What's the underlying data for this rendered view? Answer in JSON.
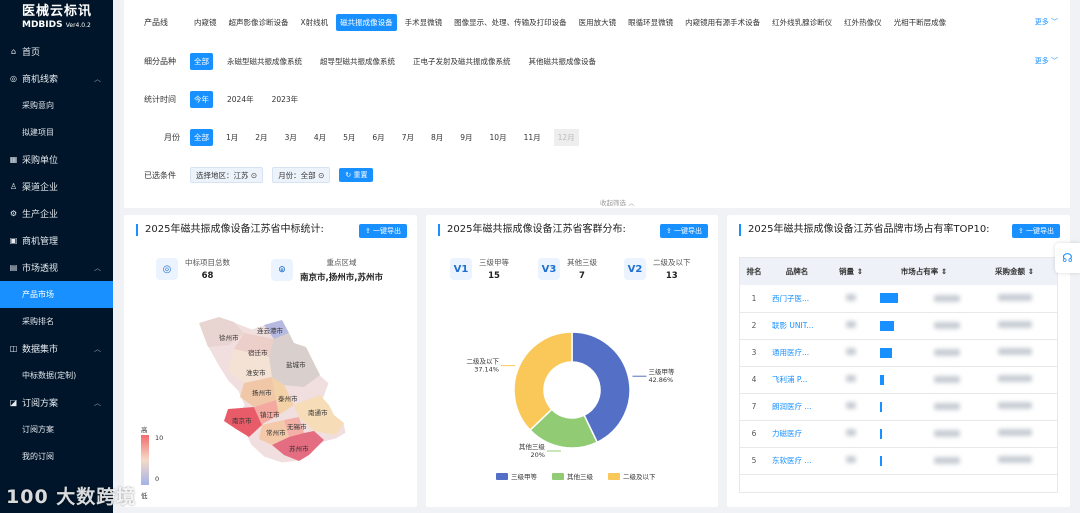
{
  "app": {
    "title": "医械云标讯",
    "subtitle": "MDBIDS",
    "version": "Ver4.0.2"
  },
  "nav": {
    "home": "首页",
    "leads": "商机线索",
    "procurement_intent": "采购意向",
    "proposed": "拟建项目",
    "buyers": "采购单位",
    "channel": "渠道企业",
    "producer": "生产企业",
    "opportunity": "商机管理",
    "market": "市场透视",
    "product_market": "产品市场",
    "purchase_rank": "采购排名",
    "data_market": "数据集市",
    "winning_data": "中标数据(定制)",
    "subscription": "订阅方案",
    "sub_plan": "订阅方案",
    "my_sub": "我的订阅"
  },
  "filters": {
    "product_line_label": "产品线",
    "product_lines": [
      "内窥镜",
      "超声影像诊断设备",
      "X射线机",
      "磁共振成像设备",
      "手术显微镜",
      "图像显示、处理、传输及打印设备",
      "医用放大镜",
      "眼循环显微镜",
      "内窥镜用有源手术设备",
      "红外线乳腺诊断仪",
      "红外热像仪",
      "光相干断层成像"
    ],
    "product_line_selected": 3,
    "sub_label": "细分品种",
    "sub_items": [
      "全部",
      "永磁型磁共振成像系统",
      "超导型磁共振成像系统",
      "正电子发射及磁共振成像系统",
      "其他磁共振成像设备"
    ],
    "time_label": "统计时间",
    "time_items": [
      "今年",
      "2024年",
      "2023年"
    ],
    "month_label": "月份",
    "month_items": [
      "全部",
      "1月",
      "2月",
      "3月",
      "4月",
      "5月",
      "6月",
      "7月",
      "8月",
      "9月",
      "10月",
      "11月",
      "12月"
    ],
    "more": "更多",
    "selected_label": "已选条件",
    "tag_region": "选择地区：江苏",
    "tag_month": "月份：全部",
    "reset": "重置",
    "collapse": "收起筛选"
  },
  "export": "一键导出",
  "card1": {
    "title": "2025年磁共振成像设备江苏省中标统计:",
    "total_label": "中标项目总数",
    "total_value": "68",
    "key_label": "重点区域",
    "key_value": "南京市,扬州市,苏州市",
    "legend_high": "高",
    "legend_low": "低",
    "legend_max": "10",
    "legend_min": "0",
    "cities": [
      "连云港市",
      "徐州市",
      "宿迁市",
      "淮安市",
      "盐城市",
      "扬州市",
      "泰州市",
      "南京市",
      "镇江市",
      "南通市",
      "常州市",
      "无锡市",
      "苏州市"
    ]
  },
  "card2": {
    "title": "2025年磁共振成像设备江苏省客群分布:",
    "s1_icon": "V1",
    "s1_label": "三级甲等",
    "s1_value": "15",
    "s2_icon": "V3",
    "s2_label": "其他三级",
    "s2_value": "7",
    "s3_icon": "V2",
    "s3_label": "二级及以下",
    "s3_value": "13",
    "colors": {
      "s1": "#5470c6",
      "s2": "#91cc75",
      "s3": "#fac858"
    }
  },
  "chart_data": {
    "type": "pie",
    "categories": [
      "三级甲等",
      "其他三级",
      "二级及以下"
    ],
    "values": [
      42.86,
      20,
      37.14
    ],
    "labels": [
      "42.86%",
      "20%",
      "37.14%"
    ]
  },
  "card3": {
    "title": "2025年磁共振成像设备江苏省品牌市场占有率TOP10:",
    "headers": [
      "排名",
      "品牌名",
      "销量",
      "市场占有率",
      "采购金额"
    ],
    "rows": [
      {
        "rank": "1",
        "brand": "西门子医...",
        "share": 0.55
      },
      {
        "rank": "2",
        "brand": "联影 UNIT...",
        "share": 0.45
      },
      {
        "rank": "3",
        "brand": "通用医疗...",
        "share": 0.38
      },
      {
        "rank": "4",
        "brand": "飞利浦 P...",
        "share": 0.14
      },
      {
        "rank": "7",
        "brand": "朗润医疗 ...",
        "share": 0.04
      },
      {
        "rank": "6",
        "brand": "力磁医疗",
        "share": 0.04
      },
      {
        "rank": "5",
        "brand": "东软医疗 ...",
        "share": 0.04
      }
    ]
  },
  "watermark": "100 大数跨境"
}
